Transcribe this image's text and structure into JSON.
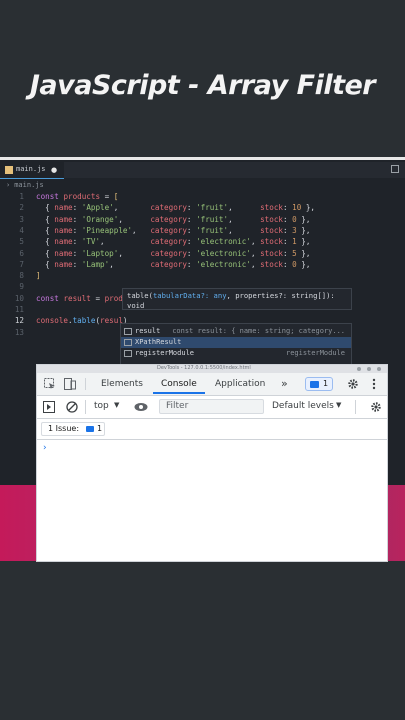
{
  "title": "JavaScript - Array Filter",
  "editor": {
    "tab_label": "main.js",
    "breadcrumb": "main.js",
    "lines": [
      {
        "n": "1",
        "tokens": [
          [
            "k",
            "const "
          ],
          [
            "v",
            "products"
          ],
          [
            "p",
            " = "
          ],
          [
            "br",
            "["
          ]
        ]
      },
      {
        "n": "2",
        "tokens": [
          [
            "p",
            "  { "
          ],
          [
            "v",
            "name"
          ],
          [
            "p",
            ": "
          ],
          [
            "s",
            "'Apple'"
          ],
          [
            "p",
            ",       "
          ],
          [
            "v",
            "category"
          ],
          [
            "p",
            ": "
          ],
          [
            "s",
            "'fruit'"
          ],
          [
            "p",
            ",      "
          ],
          [
            "v",
            "stock"
          ],
          [
            "p",
            ": "
          ],
          [
            "n",
            "10"
          ],
          [
            "p",
            " },"
          ]
        ]
      },
      {
        "n": "3",
        "tokens": [
          [
            "p",
            "  { "
          ],
          [
            "v",
            "name"
          ],
          [
            "p",
            ": "
          ],
          [
            "s",
            "'Orange'"
          ],
          [
            "p",
            ",      "
          ],
          [
            "v",
            "category"
          ],
          [
            "p",
            ": "
          ],
          [
            "s",
            "'fruit'"
          ],
          [
            "p",
            ",      "
          ],
          [
            "v",
            "stock"
          ],
          [
            "p",
            ": "
          ],
          [
            "n",
            "0"
          ],
          [
            "p",
            " },"
          ]
        ]
      },
      {
        "n": "4",
        "tokens": [
          [
            "p",
            "  { "
          ],
          [
            "v",
            "name"
          ],
          [
            "p",
            ": "
          ],
          [
            "s",
            "'Pineapple'"
          ],
          [
            "p",
            ",   "
          ],
          [
            "v",
            "category"
          ],
          [
            "p",
            ": "
          ],
          [
            "s",
            "'fruit'"
          ],
          [
            "p",
            ",      "
          ],
          [
            "v",
            "stock"
          ],
          [
            "p",
            ": "
          ],
          [
            "n",
            "3"
          ],
          [
            "p",
            " },"
          ]
        ]
      },
      {
        "n": "5",
        "tokens": [
          [
            "p",
            "  { "
          ],
          [
            "v",
            "name"
          ],
          [
            "p",
            ": "
          ],
          [
            "s",
            "'TV'"
          ],
          [
            "p",
            ",          "
          ],
          [
            "v",
            "category"
          ],
          [
            "p",
            ": "
          ],
          [
            "s",
            "'electronic'"
          ],
          [
            "p",
            ", "
          ],
          [
            "v",
            "stock"
          ],
          [
            "p",
            ": "
          ],
          [
            "n",
            "1"
          ],
          [
            "p",
            " },"
          ]
        ]
      },
      {
        "n": "6",
        "tokens": [
          [
            "p",
            "  { "
          ],
          [
            "v",
            "name"
          ],
          [
            "p",
            ": "
          ],
          [
            "s",
            "'Laptop'"
          ],
          [
            "p",
            ",      "
          ],
          [
            "v",
            "category"
          ],
          [
            "p",
            ": "
          ],
          [
            "s",
            "'electronic'"
          ],
          [
            "p",
            ", "
          ],
          [
            "v",
            "stock"
          ],
          [
            "p",
            ": "
          ],
          [
            "n",
            "5"
          ],
          [
            "p",
            " },"
          ]
        ]
      },
      {
        "n": "7",
        "tokens": [
          [
            "p",
            "  { "
          ],
          [
            "v",
            "name"
          ],
          [
            "p",
            ": "
          ],
          [
            "s",
            "'Lamp'"
          ],
          [
            "p",
            ",        "
          ],
          [
            "v",
            "category"
          ],
          [
            "p",
            ": "
          ],
          [
            "s",
            "'electronic'"
          ],
          [
            "p",
            ", "
          ],
          [
            "v",
            "stock"
          ],
          [
            "p",
            ": "
          ],
          [
            "n",
            "0"
          ],
          [
            "p",
            " },"
          ]
        ]
      },
      {
        "n": "8",
        "tokens": [
          [
            "br",
            "]"
          ]
        ]
      },
      {
        "n": "9",
        "tokens": []
      },
      {
        "n": "10",
        "tokens": [
          [
            "k",
            "const "
          ],
          [
            "v",
            "result"
          ],
          [
            "p",
            " = "
          ],
          [
            "v",
            "prod"
          ]
        ]
      },
      {
        "n": "11",
        "tokens": []
      },
      {
        "n": "12",
        "tokens": [
          [
            "v",
            "console"
          ],
          [
            "p",
            "."
          ],
          [
            "f",
            "table"
          ],
          [
            "p",
            "("
          ],
          [
            "v",
            "resul"
          ],
          [
            "p",
            ")"
          ]
        ]
      },
      {
        "n": "13",
        "tokens": []
      }
    ],
    "tooltip_line1_a": "table(",
    "tooltip_line1_b": "tabularData?: any",
    "tooltip_line1_c": ", properties?: string[]):",
    "tooltip_line2": "void",
    "suggestions": [
      {
        "label": "result",
        "desc": "const result: { name: string; category..."
      },
      {
        "label": "XPathResult",
        "desc": ""
      },
      {
        "label": "registerModule",
        "desc": "registerModule"
      }
    ]
  },
  "devtools": {
    "title_text": "DevTools - 127.0.0.1:5500/index.html",
    "tabs": [
      "Elements",
      "Console",
      "Application"
    ],
    "more_tabs": "»",
    "issue_badge_count": "1",
    "context": "top",
    "filter_placeholder": "Filter",
    "levels": "Default levels",
    "issues_label": "1 Issue:",
    "issues_count": "1",
    "prompt": "›"
  },
  "colors": {
    "accent": "#1a73e8",
    "magenta_band": "#c41a5a",
    "editor_bg": "#1f2329",
    "page_bg": "#2a2f33"
  }
}
